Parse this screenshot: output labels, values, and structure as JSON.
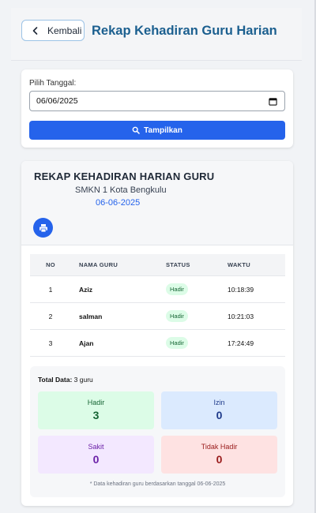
{
  "header": {
    "back_label": "Kembali",
    "title": "Rekap Kehadiran Guru Harian"
  },
  "filter": {
    "label": "Pilih Tanggal:",
    "date_value": "06/06/2025",
    "button_label": "Tampilkan"
  },
  "report": {
    "title": "REKAP KEHADIRAN HARIAN GURU",
    "school": "SMKN 1 Kota Bengkulu",
    "date": "06-06-2025",
    "columns": {
      "no": "NO",
      "name": "NAMA GURU",
      "status": "STATUS",
      "time": "WAKTU"
    },
    "rows": [
      {
        "no": "1",
        "name": "Aziz",
        "status": "Hadir",
        "time": "10:18:39"
      },
      {
        "no": "2",
        "name": "salman",
        "status": "Hadir",
        "time": "10:21:03"
      },
      {
        "no": "3",
        "name": "Ajan",
        "status": "Hadir",
        "time": "17:24:49"
      }
    ]
  },
  "summary": {
    "total_label": "Total Data:",
    "total_value": "3 guru",
    "hadir": {
      "label": "Hadir",
      "value": "3"
    },
    "izin": {
      "label": "Izin",
      "value": "0"
    },
    "sakit": {
      "label": "Sakit",
      "value": "0"
    },
    "tidak_hadir": {
      "label": "Tidak Hadir",
      "value": "0"
    },
    "note": "* Data kehadiran guru berdasarkan tanggal 06-06-2025"
  },
  "colors": {
    "primary": "#2563eb",
    "title": "#1b5f8f",
    "hadir_bg": "#dcfce7",
    "izin_bg": "#dbeafe",
    "sakit_bg": "#f3e8ff",
    "tidak_bg": "#fee2e2"
  }
}
